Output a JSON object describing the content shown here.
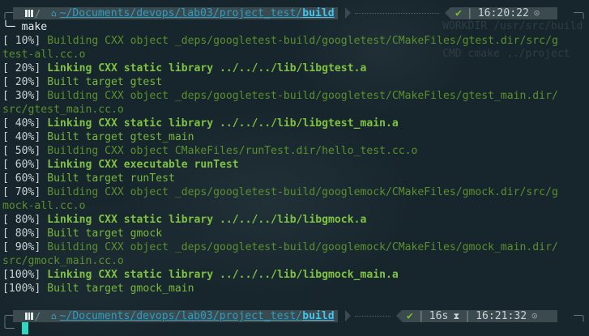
{
  "prompt1": {
    "path": "~/Documents/devops/lab03/project_test/",
    "dir": "build",
    "status": "✔",
    "time": "16:20:22"
  },
  "cmd": {
    "prefix": "╰─ ",
    "text": "make"
  },
  "out": [
    {
      "pct": "[ 10%] ",
      "text": "Building CXX object _deps/googletest-build/googletest/CMakeFiles/gtest.dir/src/g",
      "wrap": "test-all.cc.o"
    },
    {
      "pct": "[ 20%] ",
      "text": "Linking CXX static library ../../../lib/libgtest.a"
    },
    {
      "pct": "[ 20%] ",
      "text": "Built target gtest"
    },
    {
      "pct": "[ 30%] ",
      "text": "Building CXX object _deps/googletest-build/googletest/CMakeFiles/gtest_main.dir/",
      "wrap": "src/gtest_main.cc.o"
    },
    {
      "pct": "[ 40%] ",
      "text": "Linking CXX static library ../../../lib/libgtest_main.a"
    },
    {
      "pct": "[ 40%] ",
      "text": "Built target gtest_main"
    },
    {
      "pct": "[ 50%] ",
      "text": "Building CXX object CMakeFiles/runTest.dir/hello_test.cc.o"
    },
    {
      "pct": "[ 60%] ",
      "text": "Linking CXX executable runTest"
    },
    {
      "pct": "[ 60%] ",
      "text": "Built target runTest"
    },
    {
      "pct": "[ 70%] ",
      "text": "Building CXX object _deps/googletest-build/googlemock/CMakeFiles/gmock.dir/src/g",
      "wrap": "mock-all.cc.o"
    },
    {
      "pct": "[ 80%] ",
      "text": "Linking CXX static library ../../../lib/libgmock.a"
    },
    {
      "pct": "[ 80%] ",
      "text": "Built target gmock"
    },
    {
      "pct": "[ 90%] ",
      "text": "Building CXX object _deps/googletest-build/googlemock/CMakeFiles/gmock_main.dir/",
      "wrap": "src/gmock_main.cc.o"
    },
    {
      "pct": "[100%] ",
      "text": "Linking CXX static library ../../../lib/libgmock_main.a"
    },
    {
      "pct": "[100%] ",
      "text": "Built target gmock_main"
    }
  ],
  "prompt2": {
    "path": "~/Documents/devops/lab03/project_test/",
    "dir": "build",
    "status": "✔",
    "duration": "16s",
    "time": "16:21:32"
  },
  "ghost": [
    "WORKDIR /usr/src/build",
    "",
    "CMD cmake ../project"
  ]
}
